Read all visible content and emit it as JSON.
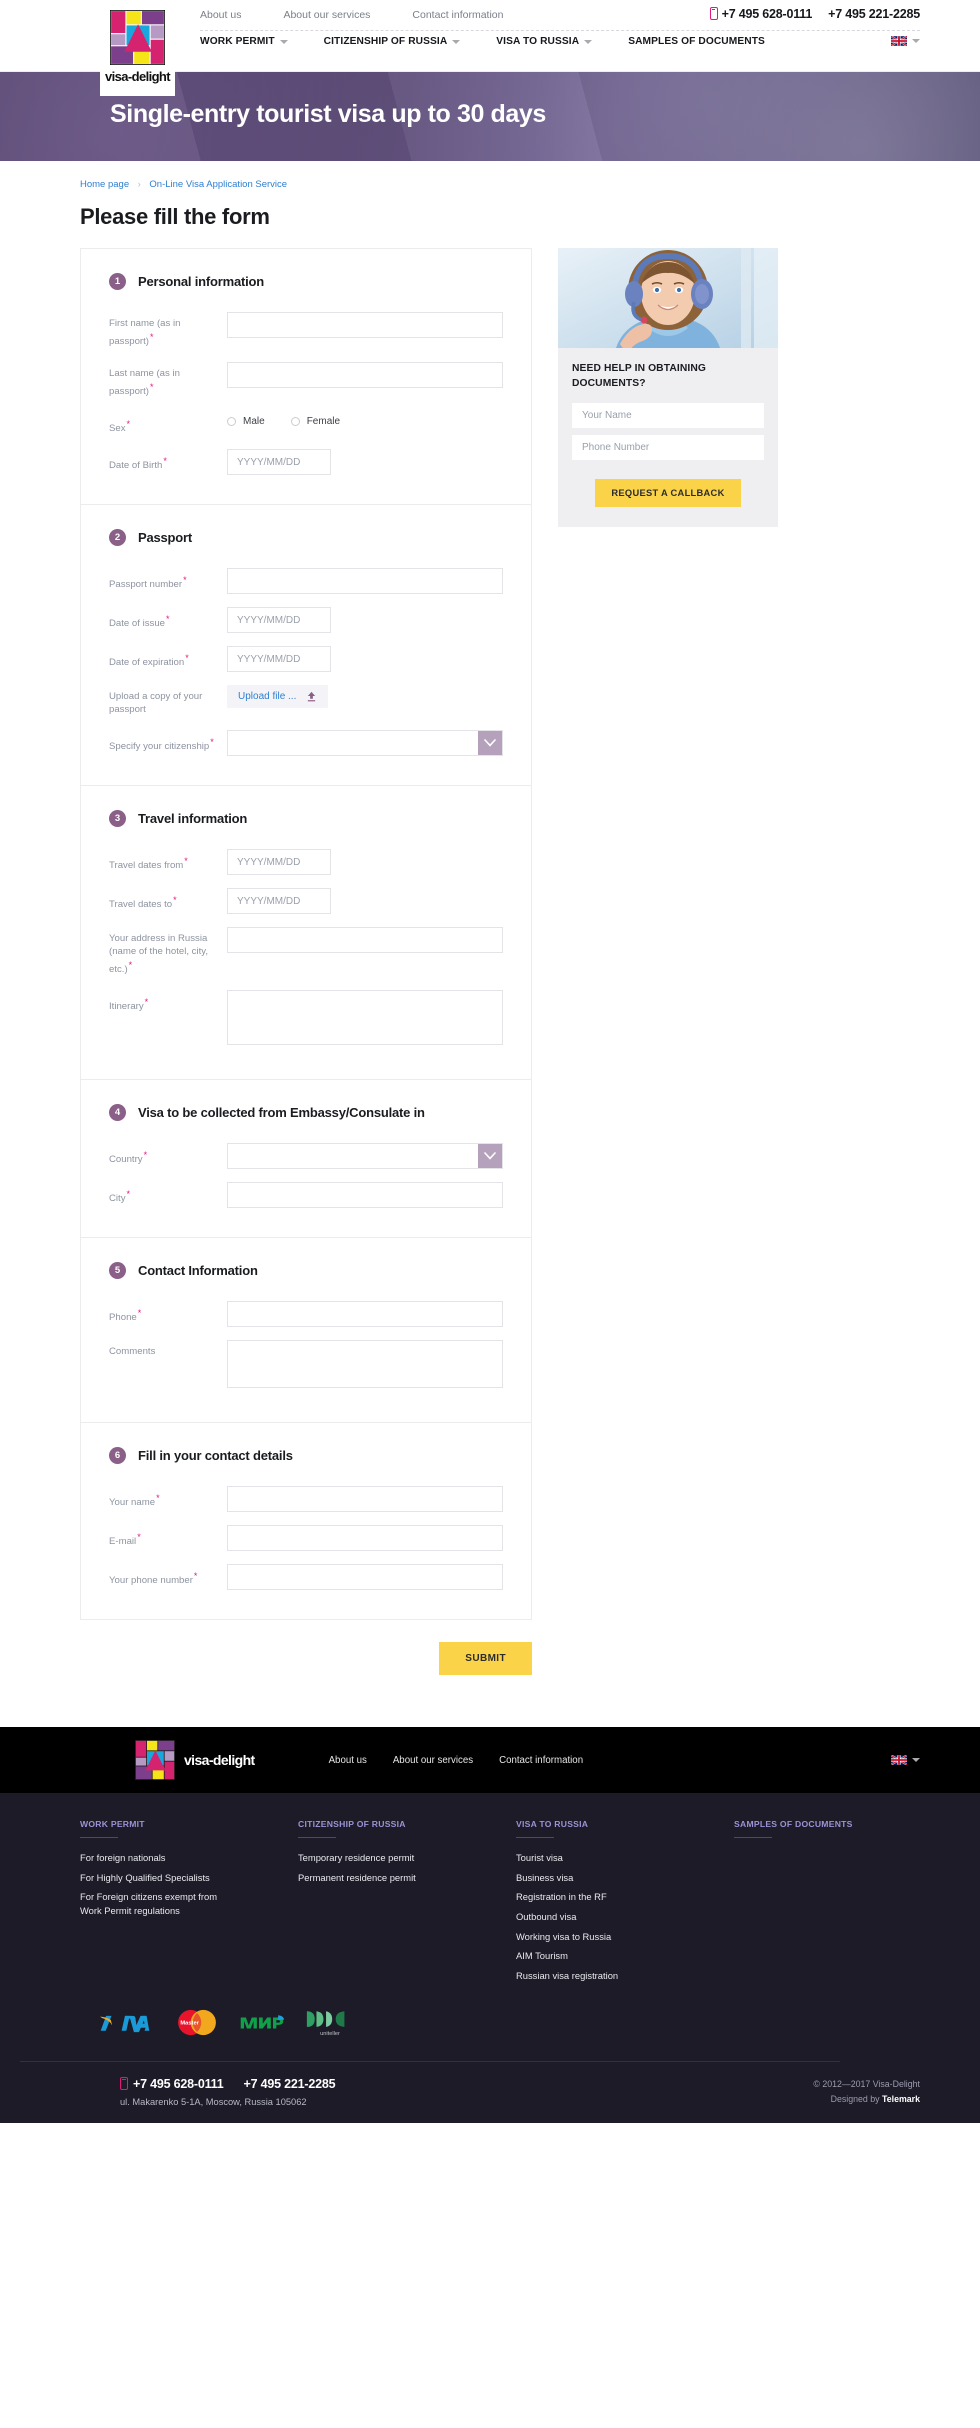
{
  "header": {
    "brand": "visa-delight",
    "top_links": [
      "About us",
      "About our services",
      "Contact information"
    ],
    "phones": [
      "+7 495 628-0111",
      "+7 495 221-2285"
    ],
    "nav": [
      {
        "label": "WORK PERMIT",
        "has_caret": true
      },
      {
        "label": "CITIZENSHIP OF RUSSIA",
        "has_caret": true
      },
      {
        "label": "VISA TO RUSSIA",
        "has_caret": true
      },
      {
        "label": "SAMPLES OF DOCUMENTS",
        "has_caret": false
      }
    ],
    "lang": "EN"
  },
  "hero": {
    "title": "Single-entry tourist visa up to 30 days"
  },
  "breadcrumb": {
    "home": "Home page",
    "separator": "›",
    "current": "On-Line Visa Application Service"
  },
  "page_title": "Please fill the form",
  "form": {
    "sections": [
      {
        "num": "1",
        "title": "Personal information",
        "fields": [
          {
            "label": "First name (as in passport)",
            "required": true,
            "type": "text",
            "placeholder": "",
            "value": ""
          },
          {
            "label": "Last name (as in passport)",
            "required": true,
            "type": "text",
            "placeholder": "",
            "value": ""
          },
          {
            "label": "Sex",
            "required": true,
            "type": "radio",
            "options": [
              "Male",
              "Female"
            ]
          },
          {
            "label": "Date of Birth",
            "required": true,
            "type": "date",
            "placeholder": "YYYY/MM/DD",
            "value": ""
          }
        ]
      },
      {
        "num": "2",
        "title": "Passport",
        "fields": [
          {
            "label": "Passport number",
            "required": true,
            "type": "text",
            "placeholder": "",
            "value": ""
          },
          {
            "label": "Date of issue",
            "required": true,
            "type": "date",
            "placeholder": "YYYY/MM/DD",
            "value": ""
          },
          {
            "label": "Date of expiration",
            "required": true,
            "type": "date",
            "placeholder": "YYYY/MM/DD",
            "value": ""
          },
          {
            "label": "Upload a copy of your passport",
            "required": false,
            "type": "upload",
            "button_label": "Upload file ..."
          },
          {
            "label": "Specify your citizenship",
            "required": true,
            "type": "select",
            "value": ""
          }
        ]
      },
      {
        "num": "3",
        "title": "Travel information",
        "fields": [
          {
            "label": "Travel dates from",
            "required": true,
            "type": "date",
            "placeholder": "YYYY/MM/DD",
            "value": ""
          },
          {
            "label": "Travel dates to",
            "required": true,
            "type": "date",
            "placeholder": "YYYY/MM/DD",
            "value": ""
          },
          {
            "label": "Your address in Russia (name of the hotel, city, etc.)",
            "required": true,
            "type": "text",
            "placeholder": "",
            "value": ""
          },
          {
            "label": "Itinerary",
            "required": true,
            "type": "textarea",
            "placeholder": "",
            "value": ""
          }
        ]
      },
      {
        "num": "4",
        "title": "Visa to be collected from Embassy/Consulate in",
        "fields": [
          {
            "label": "Country",
            "required": true,
            "type": "select",
            "value": ""
          },
          {
            "label": "City",
            "required": true,
            "type": "text",
            "placeholder": "",
            "value": ""
          }
        ]
      },
      {
        "num": "5",
        "title": "Contact Information",
        "fields": [
          {
            "label": "Phone",
            "required": true,
            "type": "text",
            "placeholder": "",
            "value": ""
          },
          {
            "label": "Comments",
            "required": false,
            "type": "textarea",
            "placeholder": "",
            "value": ""
          }
        ]
      },
      {
        "num": "6",
        "title": "Fill in your contact details",
        "fields": [
          {
            "label": "Your name",
            "required": true,
            "type": "text",
            "placeholder": "",
            "value": ""
          },
          {
            "label": "E-mail",
            "required": true,
            "type": "text",
            "placeholder": "",
            "value": ""
          },
          {
            "label": "Your phone number",
            "required": true,
            "type": "text",
            "placeholder": "",
            "value": ""
          }
        ]
      }
    ],
    "submit_label": "SUBMIT"
  },
  "callback_widget": {
    "title": "NEED HELP IN OBTAINING DOCUMENTS?",
    "name_placeholder": "Your Name",
    "name_value": "",
    "phone_placeholder": "Phone Number",
    "phone_value": "",
    "button_label": "REQUEST A CALLBACK"
  },
  "footer": {
    "brand": "visa-delight",
    "links": [
      "About us",
      "About our services",
      "Contact information"
    ],
    "lang": "EN",
    "columns": [
      {
        "heading": "WORK PERMIT",
        "items": [
          "For foreign nationals",
          "For Highly Qualified Specialists",
          "For Foreign citizens exempt from Work Permit regulations"
        ]
      },
      {
        "heading": "CITIZENSHIP OF RUSSIA",
        "items": [
          "Temporary residence permit",
          "Permanent residence permit"
        ]
      },
      {
        "heading": "VISA TO RUSSIA",
        "items": [
          "Tourist visa",
          "Business visa",
          "Registration in the RF",
          "Outbound visa",
          "Working visa to Russia",
          "AIM Tourism",
          "Russian visa registration"
        ]
      },
      {
        "heading": "SAMPLES OF DOCUMENTS",
        "items": []
      }
    ],
    "payment_logos": [
      "VISA",
      "MasterCard",
      "МИР",
      "uniteller"
    ],
    "phones": [
      "+7 495 628-0111",
      "+7 495 221-2285"
    ],
    "address": "ul. Makarenko 5-1A, Moscow, Russia 105062",
    "copyright": "© 2012—2017 Visa-Delight",
    "designed_prefix": "Designed by ",
    "designed_by": "Telemark"
  },
  "colors": {
    "accent_pink": "#e0197d",
    "accent_yellow": "#fad348",
    "purple": "#8a5f88",
    "link_blue": "#2f7fd0",
    "footer_dark": "#1c1b27"
  }
}
